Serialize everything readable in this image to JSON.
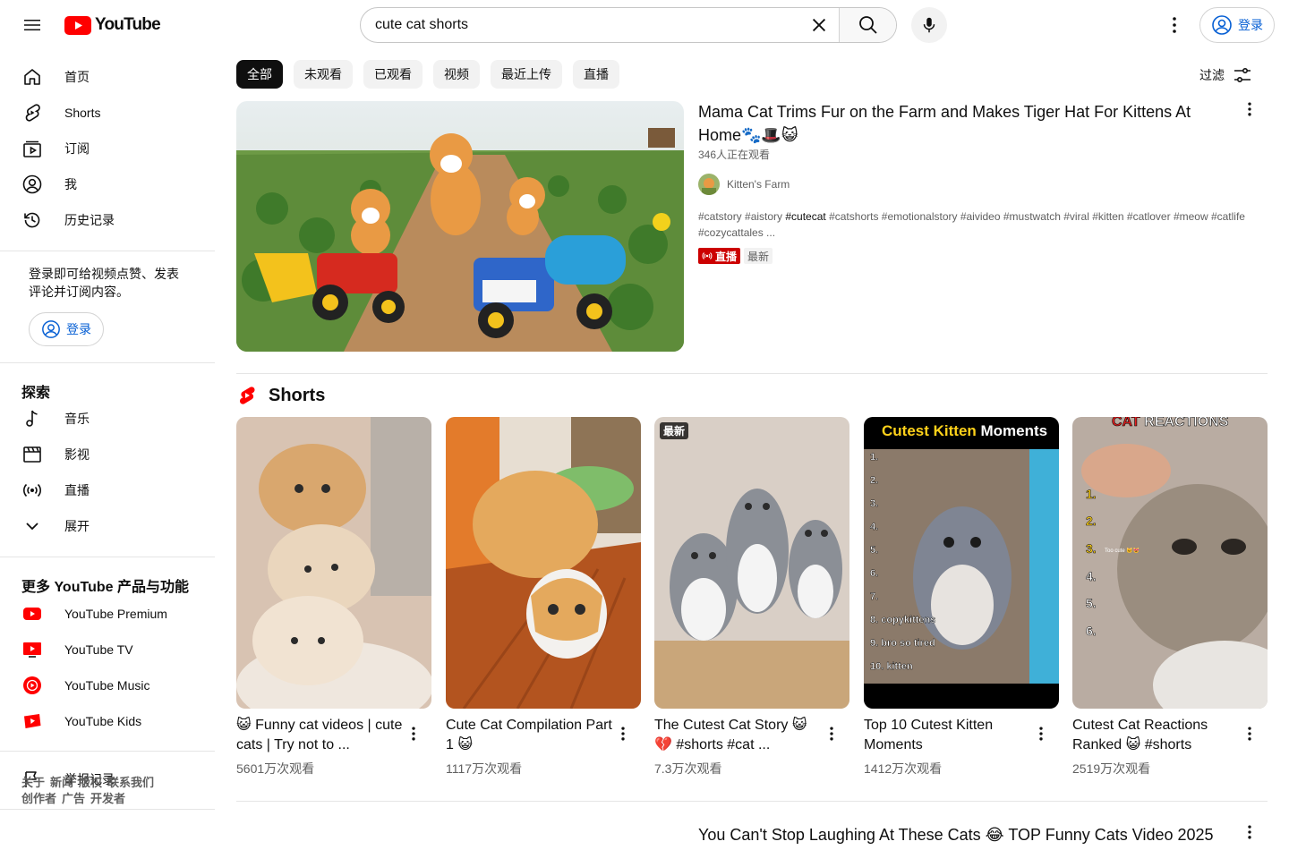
{
  "header": {
    "logo_text": "YouTube",
    "search_value": "cute cat shorts",
    "signin_label": "登录"
  },
  "sidebar": {
    "main_items": [
      {
        "label": "首页",
        "icon": "home-icon"
      },
      {
        "label": "Shorts",
        "icon": "shorts-icon"
      },
      {
        "label": "订阅",
        "icon": "subscriptions-icon"
      },
      {
        "label": "我",
        "icon": "you-icon"
      },
      {
        "label": "历史记录",
        "icon": "history-icon"
      }
    ],
    "signin_hint": "登录即可给视频点赞、发表评论并订阅内容。",
    "signin_label": "登录",
    "explore_title": "探索",
    "explore_items": [
      {
        "label": "音乐",
        "icon": "music-icon"
      },
      {
        "label": "影视",
        "icon": "movies-icon"
      },
      {
        "label": "直播",
        "icon": "live-icon"
      },
      {
        "label": "展开",
        "icon": "chevron-down-icon"
      }
    ],
    "more_title": "更多 YouTube 产品与功能",
    "more_items": [
      {
        "label": "YouTube Premium",
        "icon": "youtube-premium-icon"
      },
      {
        "label": "YouTube TV",
        "icon": "youtube-tv-icon"
      },
      {
        "label": "YouTube Music",
        "icon": "youtube-music-icon"
      },
      {
        "label": "YouTube Kids",
        "icon": "youtube-kids-icon"
      }
    ],
    "report_label": "举报记录",
    "footer_links": [
      "关于",
      "新闻",
      "版权",
      "联系我们",
      "创作者",
      "广告",
      "开发者"
    ]
  },
  "chips": [
    "全部",
    "未观看",
    "已观看",
    "视频",
    "最近上传",
    "直播"
  ],
  "filter_label": "过滤",
  "featured_video": {
    "title": "Mama Cat Trims Fur on the Farm and Makes Tiger Hat For Kittens At Home🐾🎩😺",
    "watching": "346人正在观看",
    "channel": "Kitten's Farm",
    "description_pre": "#catstory #aistory ",
    "description_bold": "#cutecat",
    "description_post": " #catshorts #emotionalstory #aivideo #mustwatch #viral #kitten #catlover #meow #catlife #cozycattales ...",
    "live_label": "直播",
    "new_label": "最新"
  },
  "shorts": {
    "title": "Shorts",
    "items": [
      {
        "title": "😺 Funny cat videos | cute cats | Try not to ...",
        "views": "5601万次观看",
        "badge": ""
      },
      {
        "title": "Cute Cat Compilation Part 1 😺",
        "views": "1117万次观看",
        "badge": ""
      },
      {
        "title": "The Cutest Cat Story 😺💔 #shorts #cat ...",
        "views": "7.3万次观看",
        "badge": "最新"
      },
      {
        "title": "Top 10 Cutest Kitten Moments",
        "views": "1412万次观看",
        "badge": ""
      },
      {
        "title": "Cutest Cat Reactions Ranked 😺 #shorts",
        "views": "2519万次观看",
        "badge": ""
      }
    ],
    "thumb_texts": {
      "kitten_heading_a": "Cutest Kitten ",
      "kitten_heading_b": "Moments",
      "kitten_list": [
        "1.",
        "2.",
        "3.",
        "4.",
        "5.",
        "6.",
        "7.",
        "8. copykittens",
        "9. bro so tired",
        "10. kitten"
      ],
      "reactions_heading_a": "CAT ",
      "reactions_heading_b": "REACTIONS",
      "reactions_list": [
        "1.",
        "2.",
        "3.",
        "4.",
        "5.",
        "6."
      ],
      "reactions_caption": "Too cute 🐱😻"
    }
  },
  "next_video": {
    "title": "You Can't Stop Laughing At These Cats 😂 TOP Funny Cats Video 2025"
  },
  "colors": {
    "brand_red": "#ff0000",
    "link_blue": "#065fd4",
    "live_red": "#cc0000"
  }
}
